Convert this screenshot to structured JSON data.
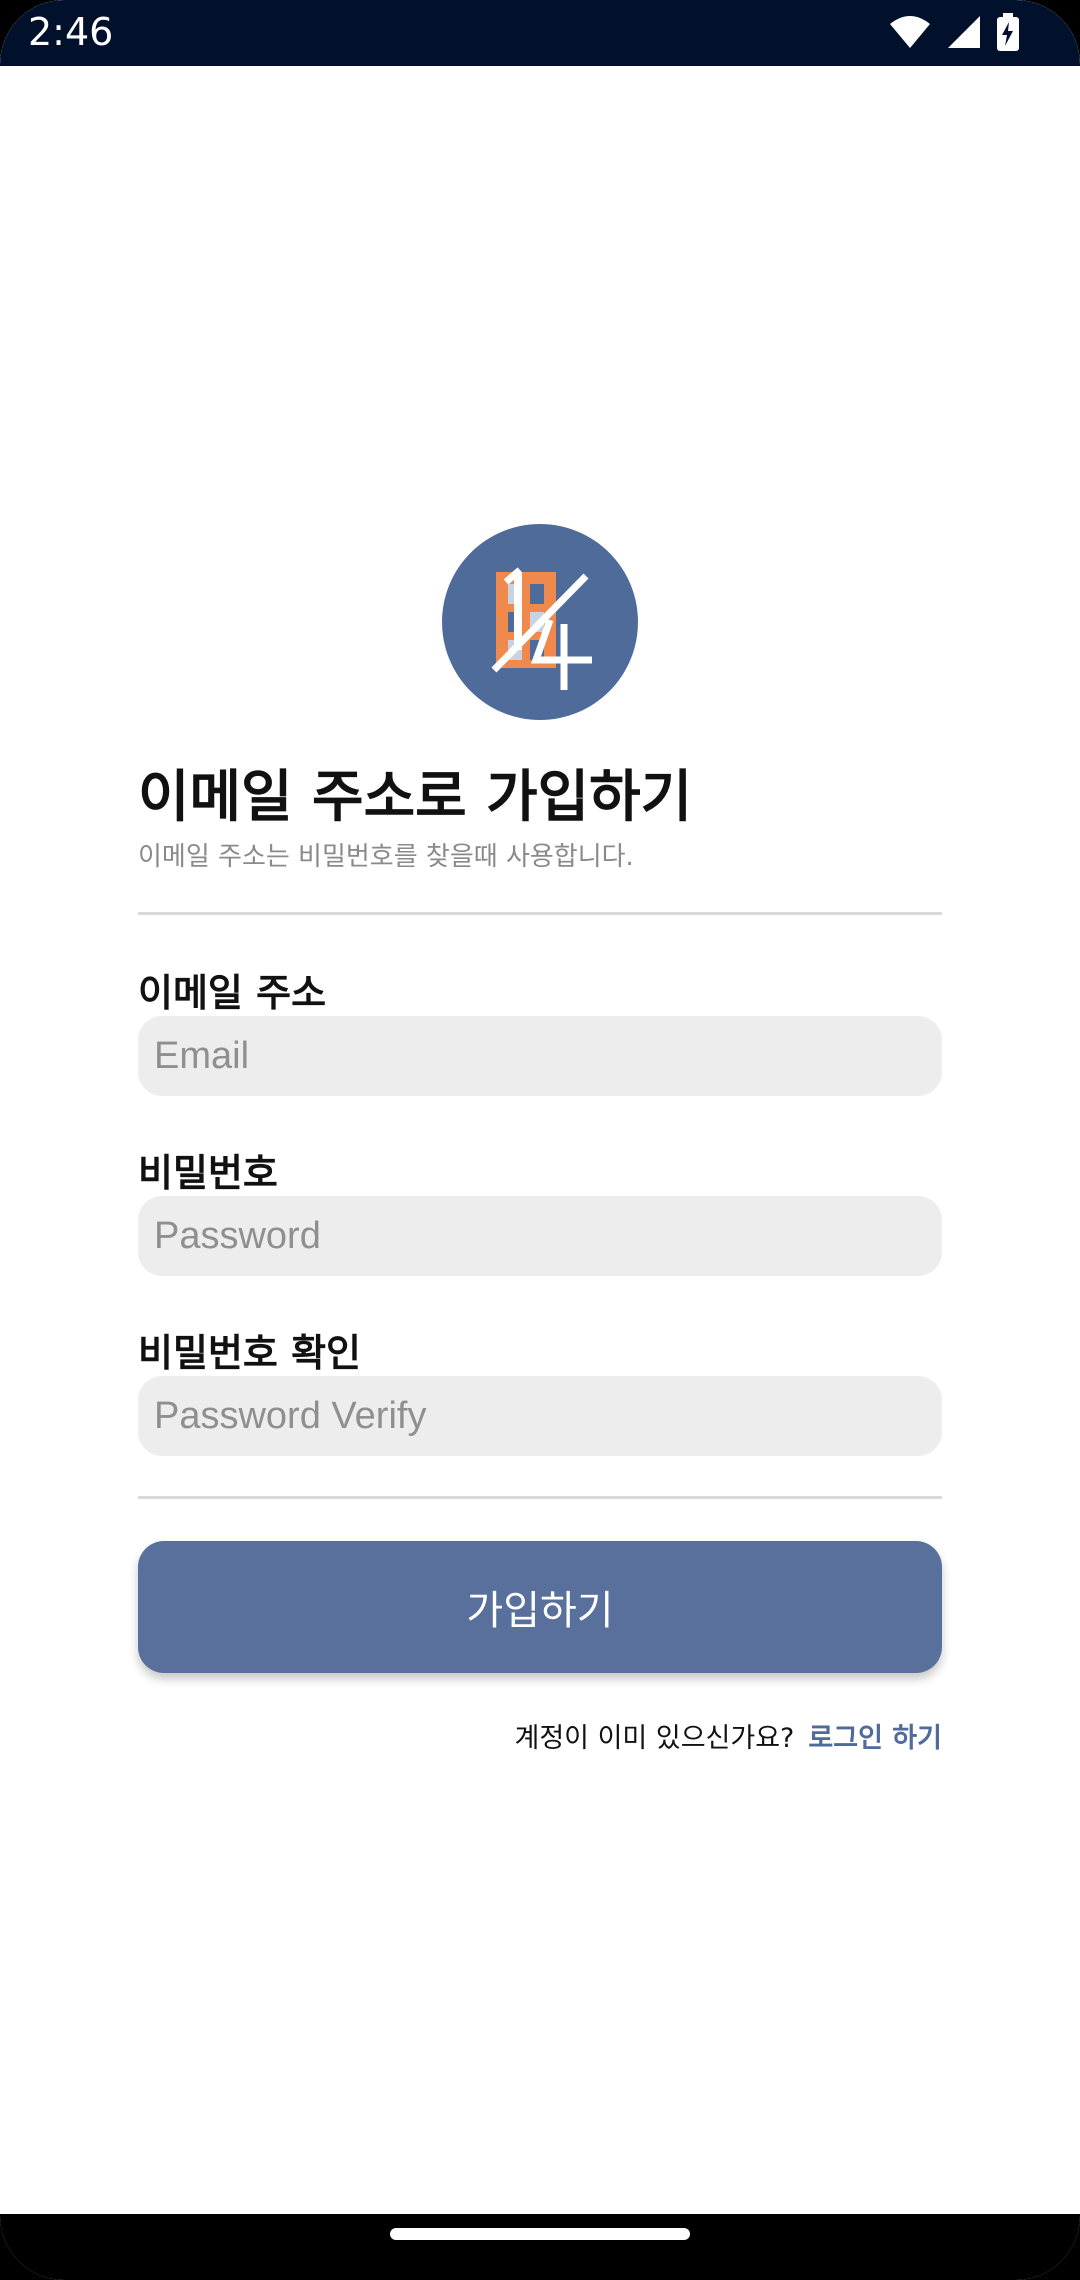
{
  "status_bar": {
    "time": "2:46",
    "icons": [
      "wifi-icon",
      "signal-icon",
      "battery-charging-icon"
    ]
  },
  "app": {
    "logo_icon": "app-logo-icon",
    "title": "이메일 주소로 가입하기",
    "subtitle": "이메일 주소는 비밀번호를 찾을때 사용합니다."
  },
  "form": {
    "email": {
      "label": "이메일 주소",
      "placeholder": "Email"
    },
    "password": {
      "label": "비밀번호",
      "placeholder": "Password"
    },
    "password_verify": {
      "label": "비밀번호 확인",
      "placeholder": "Password Verify"
    },
    "submit_label": "가입하기"
  },
  "footer": {
    "question": "계정이 이미 있으신가요?",
    "login_link": "로그인 하기"
  },
  "colors": {
    "primary": "#5a709c",
    "logo_background": "#4f6b9a",
    "logo_accent": "#f0894c",
    "status_bar": "#02112b",
    "field_background": "#ededed"
  }
}
